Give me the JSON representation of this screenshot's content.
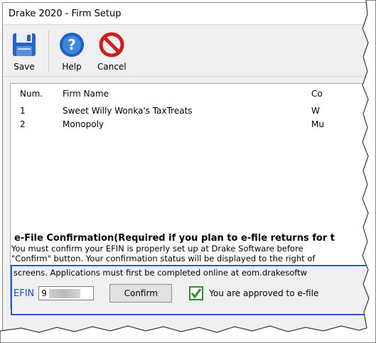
{
  "window": {
    "title": "Drake 2020 - Firm Setup"
  },
  "toolbar": {
    "save_label": "Save",
    "help_label": "Help",
    "cancel_label": "Cancel"
  },
  "grid": {
    "headers": [
      "Num.",
      "Firm Name",
      "Co"
    ],
    "rows": [
      {
        "num": "1",
        "name": "Sweet Willy Wonka's TaxTreats",
        "extra": "W"
      },
      {
        "num": "2",
        "name": "Monopoly",
        "extra": "Mu"
      }
    ]
  },
  "efile": {
    "title": "e-File Confirmation(Required if you plan to e-file returns for t",
    "line1": "You must confirm your EFIN is properly set up at Drake Software before",
    "line2": "\"Confirm\" button.  Your confirmation status will be displayed to the right of",
    "line3": "screens. Applications must first be completed online at eom.drakesoftw",
    "efin_label": "EFIN",
    "efin_value": "9",
    "confirm_label": "Confirm",
    "approved_text": "You are approved to e-file"
  },
  "icons": {
    "save": "floppy-disk-icon",
    "help": "question-mark-icon",
    "cancel": "no-entry-icon",
    "approved": "checkmark-icon"
  },
  "colors": {
    "highlight_border": "#2b55d8",
    "efin_label": "#1f4bcf",
    "check_green": "#2d8a2d",
    "cancel_red": "#d01c1c",
    "help_blue": "#1f5fbf"
  }
}
